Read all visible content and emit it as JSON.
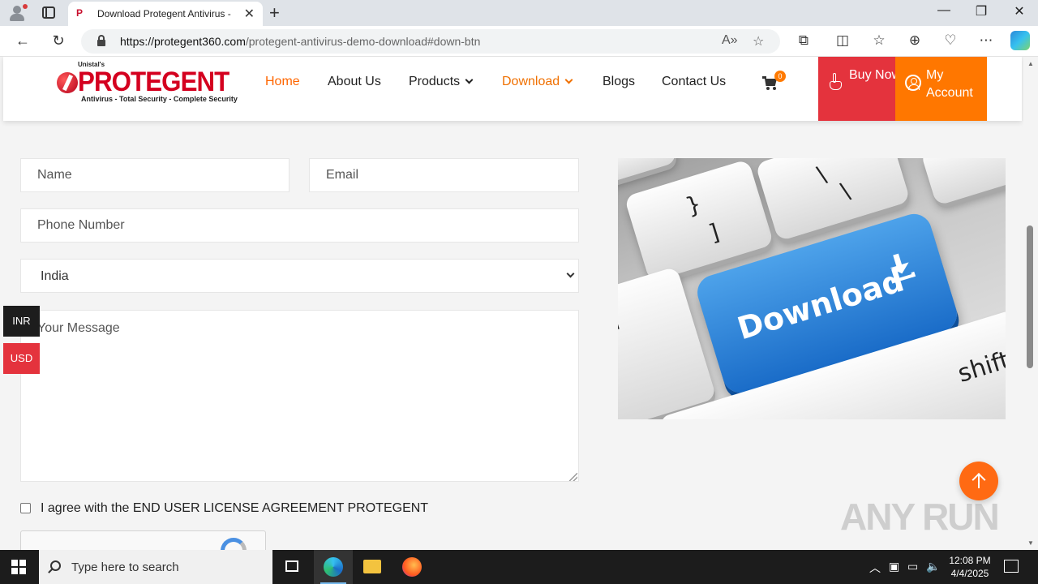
{
  "browser": {
    "tab_title": "Download Protegent Antivirus - P",
    "tab_favicon": "P",
    "url_domain": "https://protegent360.com",
    "url_path": "/protegent-antivirus-demo-download#down-btn"
  },
  "site": {
    "logo": {
      "pre": "Unistal's",
      "brand": "PROTEGENT",
      "tagline": "Antivirus - Total Security - Complete Security"
    },
    "nav": {
      "home": "Home",
      "about": "About Us",
      "products": "Products",
      "download": "Download",
      "blogs": "Blogs",
      "contact": "Contact Us"
    },
    "cart_count": "0",
    "buy_now": "Buy Now",
    "my_account": "My Account"
  },
  "form": {
    "name_placeholder": "Name",
    "email_placeholder": "Email",
    "phone_placeholder": "Phone Number",
    "country_selected": "India",
    "message_placeholder": "Your Message",
    "agree_label": "I agree with the END USER LICENSE AGREEMENT PROTEGENT"
  },
  "currency": {
    "inr": "INR",
    "usd": "USD"
  },
  "illustration": {
    "key_label": "Download",
    "shift_label": "shift",
    "brace": "}",
    "bracket": "]",
    "slash": "\\",
    "quote": "\""
  },
  "watermark": "ANY RUN",
  "taskbar": {
    "search_placeholder": "Type here to search",
    "time": "12:08 PM",
    "date": "4/4/2025"
  },
  "colors": {
    "accent_orange": "#ff6600",
    "buy_red": "#e4333d",
    "account_orange": "#ff7700",
    "brand_red": "#d4001f"
  }
}
